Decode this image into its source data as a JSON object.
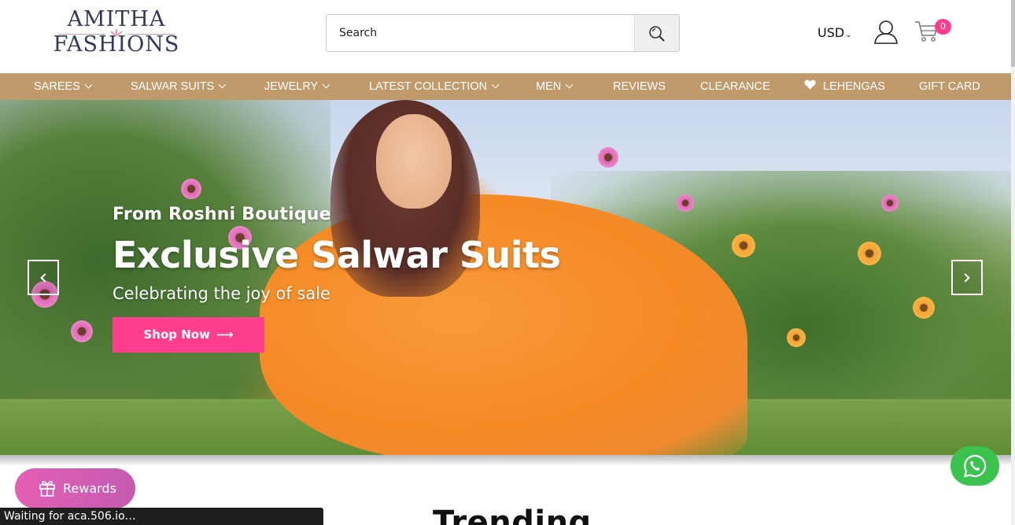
{
  "header": {
    "logo": {
      "line1": "AMITHA",
      "line2": "FASHIONS"
    },
    "search": {
      "placeholder": "Search"
    },
    "currency": {
      "value": "USD"
    },
    "cart": {
      "count": "0"
    }
  },
  "nav": {
    "items": [
      {
        "label": "SAREES",
        "dropdown": true
      },
      {
        "label": "SALWAR SUITS",
        "dropdown": true
      },
      {
        "label": "JEWELRY",
        "dropdown": true
      },
      {
        "label": "LATEST COLLECTION",
        "dropdown": true
      },
      {
        "label": "MEN",
        "dropdown": true
      },
      {
        "label": "REVIEWS",
        "dropdown": false
      },
      {
        "label": "CLEARANCE",
        "dropdown": false
      },
      {
        "label": "LEHENGAS",
        "dropdown": false,
        "icon": "heart-icon"
      },
      {
        "label": "GIFT CARD",
        "dropdown": false
      }
    ]
  },
  "hero": {
    "subtitle": "From Roshni Boutique",
    "title": "Exclusive Salwar Suits",
    "tagline": "Celebrating the joy of sale",
    "cta": "Shop Now"
  },
  "section": {
    "title": "Trending"
  },
  "rewards": {
    "label": "Rewards"
  },
  "status_bar": {
    "text": "Waiting for aca.506.io…"
  },
  "colors": {
    "nav_bg": "#c19a6b",
    "accent_pink": "#ff3f8e",
    "logo_navy": "#2f3a5c",
    "whatsapp_green": "#3cc24f",
    "rewards_gradient": [
      "#e35fb5",
      "#c45bb0"
    ]
  },
  "icons": [
    "search-icon",
    "user-icon",
    "cart-icon",
    "chevron-down-icon",
    "heart-icon",
    "arrow-right-icon",
    "chevron-left-icon",
    "chevron-right-icon",
    "gift-icon",
    "whatsapp-icon"
  ]
}
